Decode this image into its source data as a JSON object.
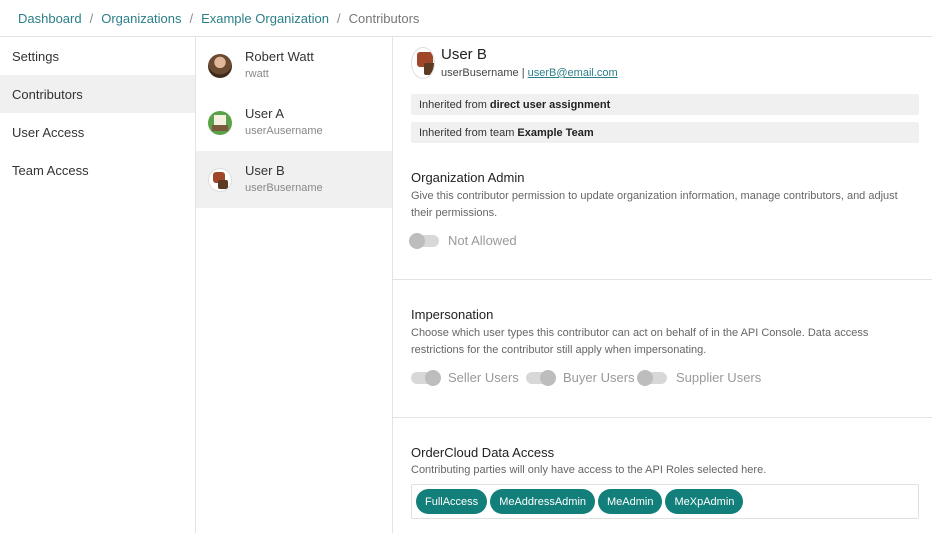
{
  "breadcrumb": {
    "items": [
      "Dashboard",
      "Organizations",
      "Example Organization"
    ],
    "separator": "/",
    "current": "Contributors"
  },
  "sidebar": {
    "items": [
      {
        "label": "Settings"
      },
      {
        "label": "Contributors",
        "active": true
      },
      {
        "label": "User Access"
      },
      {
        "label": "Team Access"
      }
    ]
  },
  "users": [
    {
      "name": "Robert Watt",
      "username": "rwatt"
    },
    {
      "name": "User A",
      "username": "userAusername"
    },
    {
      "name": "User B",
      "username": "userBusername",
      "active": true
    }
  ],
  "detail": {
    "name": "User B",
    "username": "userBusername",
    "separator": "|",
    "email": "userB@email.com",
    "inherit_direct_prefix": "Inherited from",
    "inherit_direct_value": "direct user assignment",
    "inherit_team_prefix": "Inherited from team",
    "inherit_team_value": "Example Team"
  },
  "org_admin": {
    "title": "Organization Admin",
    "description": "Give this contributor permission to update organization information, manage contributors, and adjust their permissions.",
    "toggle_label": "Not Allowed",
    "toggle_on": false
  },
  "impersonation": {
    "title": "Impersonation",
    "description": "Choose which user types this contributor can act on behalf of in the API Console. Data access restrictions for the contributor still apply when impersonating.",
    "toggles": [
      {
        "label": "Seller Users",
        "on": true
      },
      {
        "label": "Buyer Users",
        "on": true
      },
      {
        "label": "Supplier Users",
        "on": false
      }
    ]
  },
  "data_access": {
    "title": "OrderCloud Data Access",
    "description": "Contributing parties will only have access to the API Roles selected here.",
    "roles": [
      "FullAccess",
      "MeAddressAdmin",
      "MeAdmin",
      "MeXpAdmin"
    ]
  },
  "colors": {
    "accent": "#2b7f88",
    "role_pill": "#137f7a",
    "active_bg": "#f0f0f0"
  }
}
